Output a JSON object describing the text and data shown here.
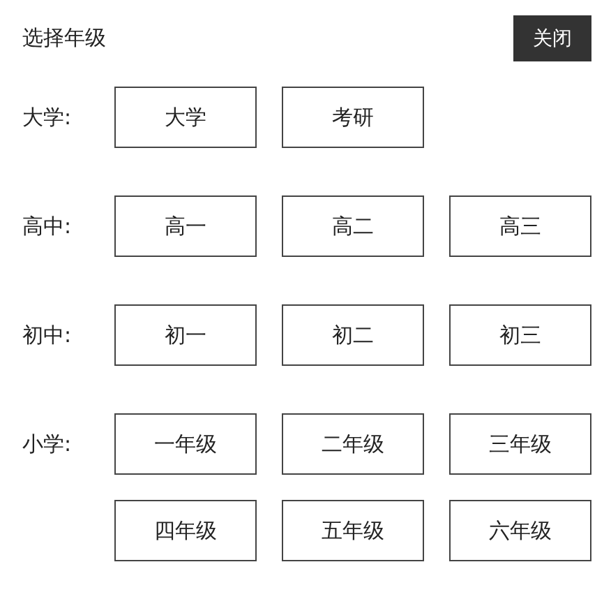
{
  "header": {
    "title": "选择年级",
    "close_button": "关闭"
  },
  "groups": [
    {
      "label": "大学:",
      "options": [
        "大学",
        "考研"
      ]
    },
    {
      "label": "高中:",
      "options": [
        "高一",
        "高二",
        "高三"
      ]
    },
    {
      "label": "初中:",
      "options": [
        "初一",
        "初二",
        "初三"
      ]
    },
    {
      "label": "小学:",
      "options": [
        "一年级",
        "二年级",
        "三年级",
        "四年级",
        "五年级",
        "六年级"
      ]
    }
  ]
}
